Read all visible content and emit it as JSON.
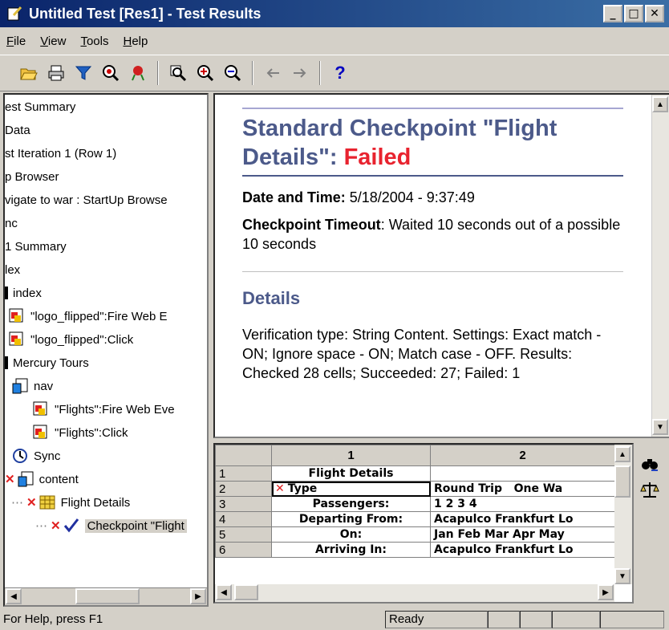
{
  "window": {
    "title": "Untitled Test [Res1] - Test Results",
    "minimize": "_",
    "maximize": "□",
    "close": "✕"
  },
  "menu": [
    "File",
    "View",
    "Tools",
    "Help"
  ],
  "toolbar": {
    "icons": [
      "open-icon",
      "print-icon",
      "filter-icon",
      "find-icon",
      "bookmark-icon",
      "zoom-fit-icon",
      "zoom-in-icon",
      "zoom-out-icon",
      "back-icon",
      "forward-icon",
      "help-icon"
    ],
    "help_label": "?"
  },
  "tree": {
    "items": [
      "est Summary",
      "Data",
      "st Iteration 1 (Row 1)",
      "p Browser",
      "vigate to war : StartUp Browse",
      "nc",
      "1 Summary",
      "lex",
      "index",
      "\"logo_flipped\":Fire Web E",
      "\"logo_flipped\":Click",
      "Mercury Tours",
      "nav",
      "\"Flights\":Fire Web Eve",
      "\"Flights\":Click",
      "Sync",
      "content",
      "Flight Details",
      "Checkpoint \"Flight"
    ]
  },
  "report": {
    "title_prefix": "Standard Checkpoint \"Flight Details\": ",
    "title_status": "Failed",
    "date_label": "Date and Time:",
    "date_value": " 5/18/2004 - 9:37:49",
    "timeout_label": "Checkpoint Timeout",
    "timeout_value": ": Waited 10 seconds out of a possible 10 seconds",
    "details_heading": "Details",
    "details_text": "Verification type: String Content. Settings: Exact match - ON; Ignore space - ON; Match case - OFF. Results: Checked 28 cells; Succeeded: 27; Failed: 1"
  },
  "grid": {
    "col_headers": [
      "1",
      "2"
    ],
    "rows": [
      {
        "n": "1",
        "c1": "Flight Details",
        "c2": ""
      },
      {
        "n": "2",
        "c1": "Type",
        "c2": "Round Trip   One Wa"
      },
      {
        "n": "3",
        "c1": "Passengers:",
        "c2": "1 2 3 4"
      },
      {
        "n": "4",
        "c1": "Departing From:",
        "c2": "Acapulco Frankfurt Lo"
      },
      {
        "n": "5",
        "c1": "On:",
        "c2": "Jan Feb Mar Apr May"
      },
      {
        "n": "6",
        "c1": "Arriving In:",
        "c2": "Acapulco Frankfurt Lo"
      }
    ]
  },
  "status": {
    "help": "For Help, press F1",
    "state": "Ready"
  },
  "colors": {
    "title_blue": "#4c5a8a",
    "failed_red": "#e8232f"
  }
}
